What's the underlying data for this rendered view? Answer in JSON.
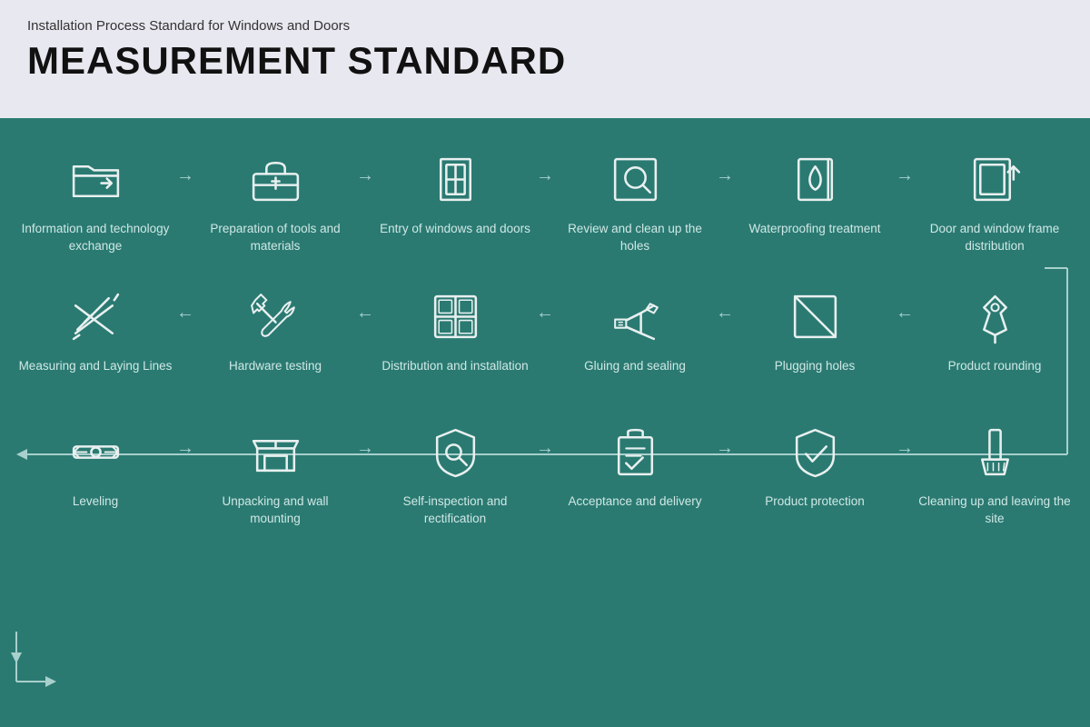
{
  "header": {
    "subtitle": "Installation Process Standard for Windows and Doors",
    "title": "MEASUREMENT STANDARD"
  },
  "colors": {
    "bg_header": "#e8e8f0",
    "bg_main": "#2a7a72",
    "text_label": "#d0e8e5",
    "icon_stroke": "#e8f0ef",
    "arrow_color": "#a8d0cc"
  },
  "row1": [
    {
      "id": "info-exchange",
      "label": "Information and technology exchange",
      "icon": "folder"
    },
    {
      "id": "preparation",
      "label": "Preparation of tools and materials",
      "icon": "toolbox"
    },
    {
      "id": "entry-windows",
      "label": "Entry of windows and doors",
      "icon": "door-frame"
    },
    {
      "id": "review-holes",
      "label": "Review and clean up the holes",
      "icon": "magnify"
    },
    {
      "id": "waterproofing",
      "label": "Waterproofing treatment",
      "icon": "waterproof"
    },
    {
      "id": "frame-dist",
      "label": "Door and window frame distribution",
      "icon": "frame-export"
    }
  ],
  "row2": [
    {
      "id": "measuring",
      "label": "Measuring and Laying Lines",
      "icon": "ruler-pencil"
    },
    {
      "id": "hardware",
      "label": "Hardware testing",
      "icon": "wrench"
    },
    {
      "id": "distribution",
      "label": "Distribution and installation",
      "icon": "grid-panel"
    },
    {
      "id": "gluing",
      "label": "Gluing and sealing",
      "icon": "glue-gun"
    },
    {
      "id": "plugging",
      "label": "Plugging holes",
      "icon": "plug-hole"
    },
    {
      "id": "rounding",
      "label": "Product rounding",
      "icon": "pin"
    }
  ],
  "row3": [
    {
      "id": "leveling",
      "label": "Leveling",
      "icon": "level"
    },
    {
      "id": "unpacking",
      "label": "Unpacking and wall mounting",
      "icon": "unpack"
    },
    {
      "id": "self-inspect",
      "label": "Self-inspection and rectification",
      "icon": "inspect"
    },
    {
      "id": "acceptance",
      "label": "Acceptance and delivery",
      "icon": "accept"
    },
    {
      "id": "protection",
      "label": "Product protection",
      "icon": "shield"
    },
    {
      "id": "cleanup",
      "label": "Cleaning up and leaving the site",
      "icon": "broom"
    }
  ]
}
